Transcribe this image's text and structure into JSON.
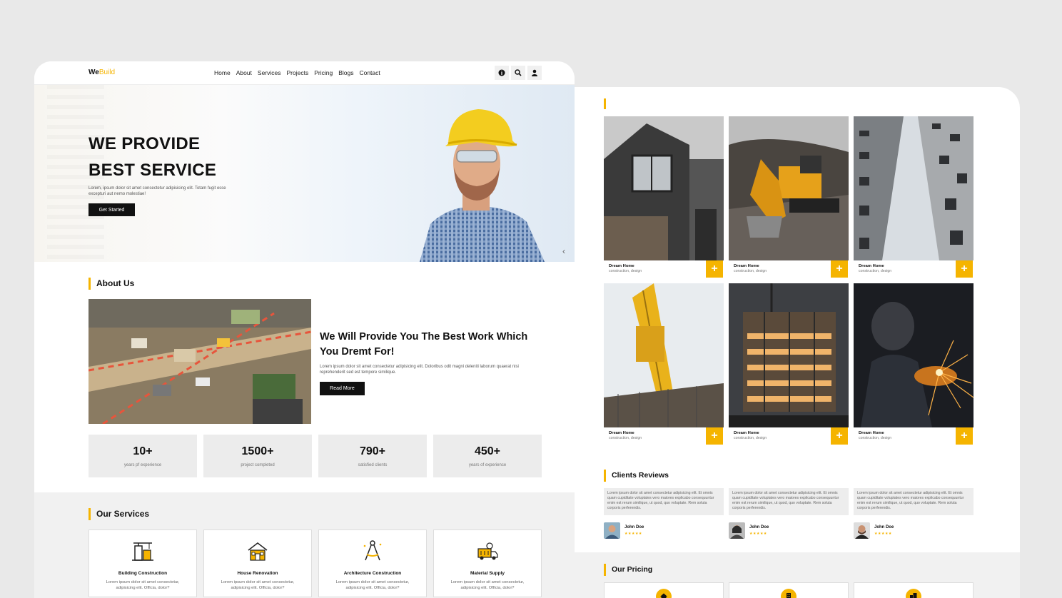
{
  "nav": {
    "logo_part1": "We",
    "logo_part2": "Build",
    "links": [
      "Home",
      "About",
      "Services",
      "Projects",
      "Pricing",
      "Blogs",
      "Contact"
    ],
    "icons": [
      "info-icon",
      "search-icon",
      "user-icon"
    ]
  },
  "hero": {
    "title_line1": "WE PROVIDE",
    "title_line2": "BEST SERVICE",
    "subtitle": "Lorem, ipsum dolor sit amet consectetur adipisicing elit. Totam fugit esse excepturi aut nemo molestiae!",
    "button": "Get Started",
    "arrow": "‹"
  },
  "about": {
    "section_title": "About Us",
    "heading": "We Will Provide You The Best Work Which You Dremt For!",
    "text": "Lorem ipsum dolor sit amet consectetur adipisicing elit. Doloribus odit magni deleniti laborum quaerat nisi reprehenderit sed est tempore similique.",
    "button": "Read More"
  },
  "stats": [
    {
      "value": "10+",
      "label": "years pf experience"
    },
    {
      "value": "1500+",
      "label": "project completed"
    },
    {
      "value": "790+",
      "label": "satisfied clients"
    },
    {
      "value": "450+",
      "label": "years of experience"
    }
  ],
  "services": {
    "section_title": "Our Services",
    "items": [
      {
        "name": "Building Construction",
        "desc": "Lorem ipsum dolor sit amet consectetur, adipisicing elit. Officia, dolor?"
      },
      {
        "name": "House Renovation",
        "desc": "Lorem ipsum dolor sit amet consectetur, adipisicing elit. Officia, dolor?"
      },
      {
        "name": "Architecture Construction",
        "desc": "Lorem ipsum dolor sit amet consectetur, adipisicing elit. Officia, dolor?"
      },
      {
        "name": "Material Supply",
        "desc": "Lorem ipsum dolor sit amet consectetur, adipisicing elit. Officia, dolor?"
      }
    ]
  },
  "gallery": [
    {
      "title": "Dream Home",
      "sub": "construction, design"
    },
    {
      "title": "Dream Home",
      "sub": "construction, design"
    },
    {
      "title": "Dream Home",
      "sub": "construction, design"
    },
    {
      "title": "Dream Home",
      "sub": "construction, design"
    },
    {
      "title": "Dream Home",
      "sub": "construction, design"
    },
    {
      "title": "Dream Home",
      "sub": "construction, design"
    }
  ],
  "gallery_plus": "+",
  "reviews": {
    "section_title": "Clients Reviews",
    "items": [
      {
        "text": "Lorem ipsum dolor sit amet consectetur adipisicing elit. Et omnis quam cupiditate voluptates vero maiores explicabo consequuntur enim est rerum similique, ut quod, quo voluptate. Rem soluta corporis perferendis.",
        "name": "John Doe",
        "stars": "★★★★★"
      },
      {
        "text": "Lorem ipsum dolor sit amet consectetur adipisicing elit. Et omnis quam cupiditate voluptates vero maiores explicabo consequuntur enim est rerum similique, ut quod, quo voluptate. Rem soluta corporis perferendis.",
        "name": "John Doe",
        "stars": "★★★★★"
      },
      {
        "text": "Lorem ipsum dolor sit amet consectetur adipisicing elit. Et omnis quam cupiditate voluptates vero maiores explicabo consequuntur enim est rerum similique, ut quod, quo voluptate. Rem soluta corporis perferendis.",
        "name": "John Doe",
        "stars": "★★★★★"
      }
    ]
  },
  "pricing": {
    "section_title": "Our Pricing",
    "icons": [
      "home-icon",
      "building-icon",
      "city-icon"
    ]
  },
  "colors": {
    "accent": "#f5b400",
    "dark": "#111111",
    "page_bg": "#e9e9e9"
  }
}
